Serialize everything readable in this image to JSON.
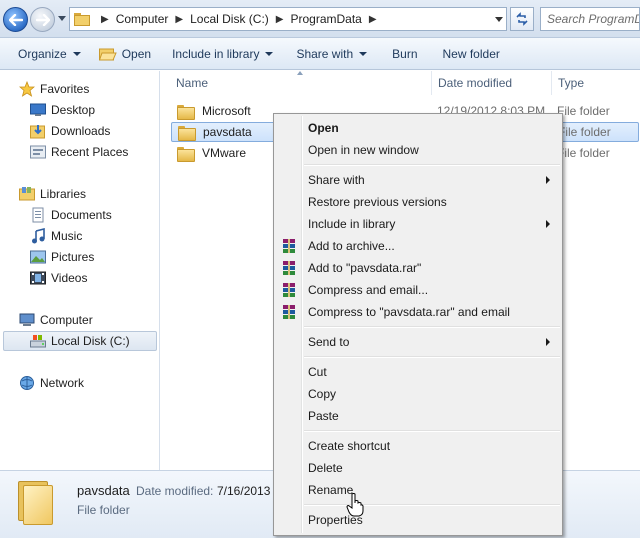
{
  "address_bar": {
    "breadcrumbs": [
      "Computer",
      "Local Disk (C:)",
      "ProgramData"
    ],
    "search_placeholder": "Search ProgramData"
  },
  "toolbar": {
    "organize": "Organize",
    "open": "Open",
    "include_in_library": "Include in library",
    "share_with": "Share with",
    "burn": "Burn",
    "new_folder": "New folder"
  },
  "nav": {
    "favorites": "Favorites",
    "desktop": "Desktop",
    "downloads": "Downloads",
    "recent_places": "Recent Places",
    "libraries": "Libraries",
    "documents": "Documents",
    "music": "Music",
    "pictures": "Pictures",
    "videos": "Videos",
    "computer": "Computer",
    "local_disk": "Local Disk (C:)",
    "network": "Network"
  },
  "columns": {
    "name": "Name",
    "date_modified": "Date modified",
    "type": "Type"
  },
  "files": [
    {
      "name": "Microsoft",
      "date": "12/19/2012 8:03 PM",
      "type": "File folder"
    },
    {
      "name": "pavsdata",
      "date": "",
      "type": "File folder"
    },
    {
      "name": "VMware",
      "date": "",
      "type": "File folder"
    }
  ],
  "context_menu": {
    "open": "Open",
    "open_new_window": "Open in new window",
    "share_with": "Share with",
    "restore_previous_versions": "Restore previous versions",
    "include_in_library": "Include in library",
    "add_to_archive": "Add to archive...",
    "add_to_rar": "Add to \"pavsdata.rar\"",
    "compress_email": "Compress and email...",
    "compress_rar_email": "Compress to \"pavsdata.rar\" and email",
    "send_to": "Send to",
    "cut": "Cut",
    "copy": "Copy",
    "paste": "Paste",
    "create_shortcut": "Create shortcut",
    "delete": "Delete",
    "rename": "Rename",
    "properties": "Properties"
  },
  "details": {
    "name": "pavsdata",
    "date_key": "Date modified:",
    "date_value": "7/16/2013",
    "type": "File folder"
  }
}
